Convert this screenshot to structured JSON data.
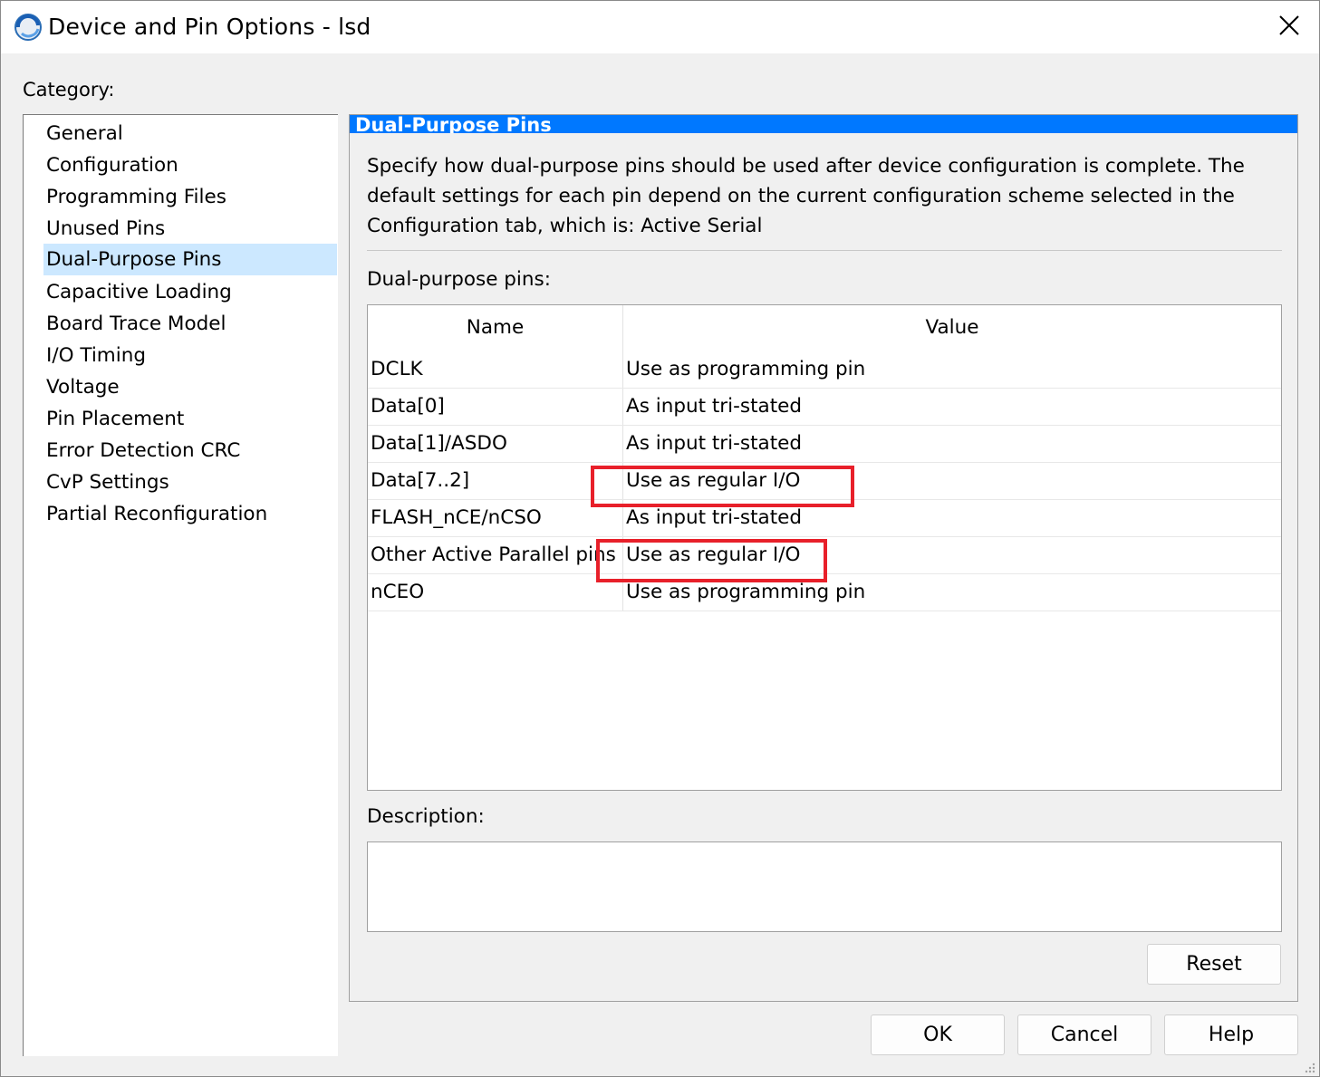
{
  "window": {
    "title": "Device and Pin Options - lsd"
  },
  "sidebar": {
    "label": "Category:",
    "items": [
      {
        "label": "General"
      },
      {
        "label": "Configuration"
      },
      {
        "label": "Programming Files"
      },
      {
        "label": "Unused Pins"
      },
      {
        "label": "Dual-Purpose Pins",
        "selected": true
      },
      {
        "label": "Capacitive Loading"
      },
      {
        "label": "Board Trace Model"
      },
      {
        "label": "I/O Timing"
      },
      {
        "label": "Voltage"
      },
      {
        "label": "Pin Placement"
      },
      {
        "label": "Error Detection CRC"
      },
      {
        "label": "CvP Settings"
      },
      {
        "label": "Partial Reconfiguration"
      }
    ]
  },
  "panel": {
    "header": "Dual-Purpose Pins",
    "description_lines": [
      "Specify how dual-purpose pins should be used after device configuration is complete. The",
      "default settings for each pin depend on the current configuration scheme selected in the",
      "Configuration tab, which is:  Active Serial"
    ],
    "pins_label": "Dual-purpose pins:",
    "table": {
      "headers": {
        "name": "Name",
        "value": "Value"
      },
      "rows": [
        {
          "name": "DCLK",
          "value": "Use as programming pin"
        },
        {
          "name": "Data[0]",
          "value": "As input tri-stated"
        },
        {
          "name": "Data[1]/ASDO",
          "value": "As input tri-stated"
        },
        {
          "name": "Data[7..2]",
          "value": "Use as regular I/O"
        },
        {
          "name": "FLASH_nCE/nCSO",
          "value": "As input tri-stated"
        },
        {
          "name": "Other Active Parallel pins",
          "value": "Use as regular I/O"
        },
        {
          "name": "nCEO",
          "value": "Use as programming pin"
        }
      ]
    },
    "description_label": "Description:",
    "description_value": "",
    "reset_label": "Reset"
  },
  "footer": {
    "ok_label": "OK",
    "cancel_label": "Cancel",
    "help_label": "Help"
  },
  "colors": {
    "accent": "#0078ff",
    "selection": "#cce8ff",
    "annotation": "#e8202a"
  },
  "icons": {
    "app": "app-logo-icon",
    "close": "close-icon",
    "grip": "resize-grip-icon"
  }
}
